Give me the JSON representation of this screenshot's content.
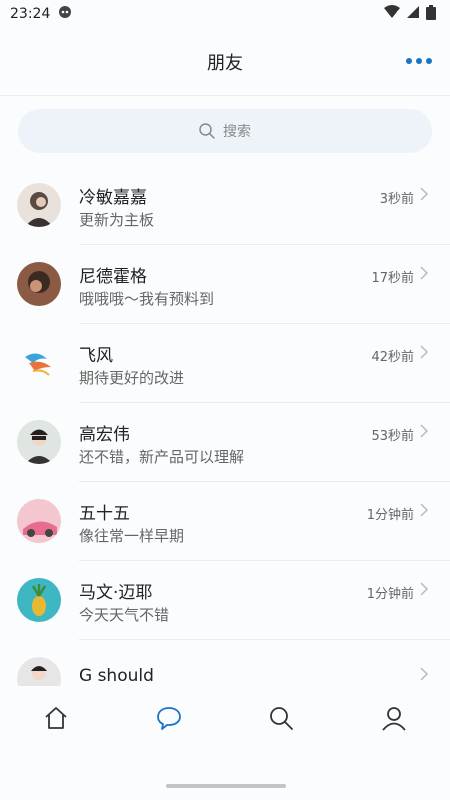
{
  "status_bar": {
    "time": "23:24",
    "icons": [
      "notification-icon",
      "wifi-icon",
      "signal-icon",
      "battery-icon"
    ]
  },
  "header": {
    "title": "朋友",
    "more_icon": "more-dots-icon",
    "accent_color": "#1a73c6"
  },
  "search": {
    "placeholder": "搜索",
    "icon": "search-icon"
  },
  "friends": [
    {
      "name": "冷敏嘉嘉",
      "message": "更新为主板",
      "time": "3秒前"
    },
    {
      "name": "尼德霍格",
      "message": "哦哦哦～我有预料到",
      "time": "17秒前"
    },
    {
      "name": "飞风",
      "message": "期待更好的改进",
      "time": "42秒前"
    },
    {
      "name": "高宏伟",
      "message": "还不错，新产品可以理解",
      "time": "53秒前"
    },
    {
      "name": "五十五",
      "message": "像往常一样早期",
      "time": "1分钟前"
    },
    {
      "name": "马文·迈耶",
      "message": "今天天气不错",
      "time": "1分钟前"
    },
    {
      "name": "G should",
      "message": "",
      "time": ""
    }
  ],
  "tabbar": {
    "tabs": [
      {
        "icon": "home-icon",
        "active": false
      },
      {
        "icon": "chat-icon",
        "active": true
      },
      {
        "icon": "search-icon",
        "active": false
      },
      {
        "icon": "profile-icon",
        "active": false
      }
    ]
  }
}
